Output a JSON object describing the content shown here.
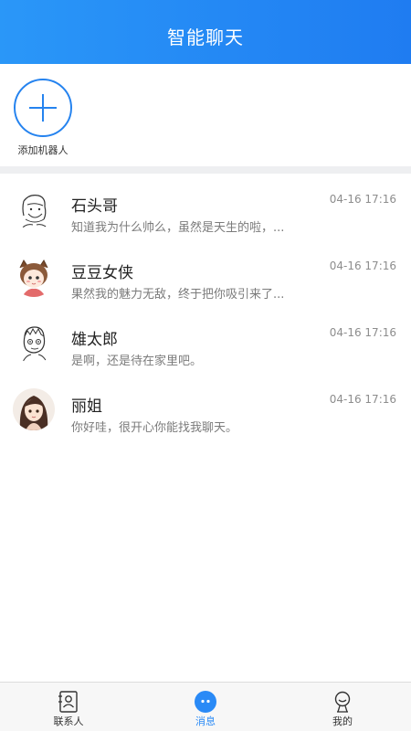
{
  "header": {
    "title": "智能聊天"
  },
  "add_robot": {
    "label": "添加机器人"
  },
  "chats": [
    {
      "name": "石头哥",
      "time": "04-16 17:16",
      "message": "知道我为什么帅么，虽然是天生的啦，..."
    },
    {
      "name": "豆豆女侠",
      "time": "04-16 17:16",
      "message": "果然我的魅力无敌，终于把你吸引来了..."
    },
    {
      "name": "雄太郎",
      "time": "04-16 17:16",
      "message": "是啊，还是待在家里吧。"
    },
    {
      "name": "丽姐",
      "time": "04-16 17:16",
      "message": "你好哇，很开心你能找我聊天。"
    }
  ],
  "tabbar": {
    "items": [
      {
        "label": "联系人",
        "icon": "contacts-icon"
      },
      {
        "label": "消息",
        "icon": "message-icon",
        "active": true
      },
      {
        "label": "我的",
        "icon": "profile-icon"
      }
    ]
  },
  "colors": {
    "accent": "#2583ef",
    "header_start": "#2a97f8",
    "header_end": "#1f7cf1",
    "divider": "#eeeff1"
  }
}
